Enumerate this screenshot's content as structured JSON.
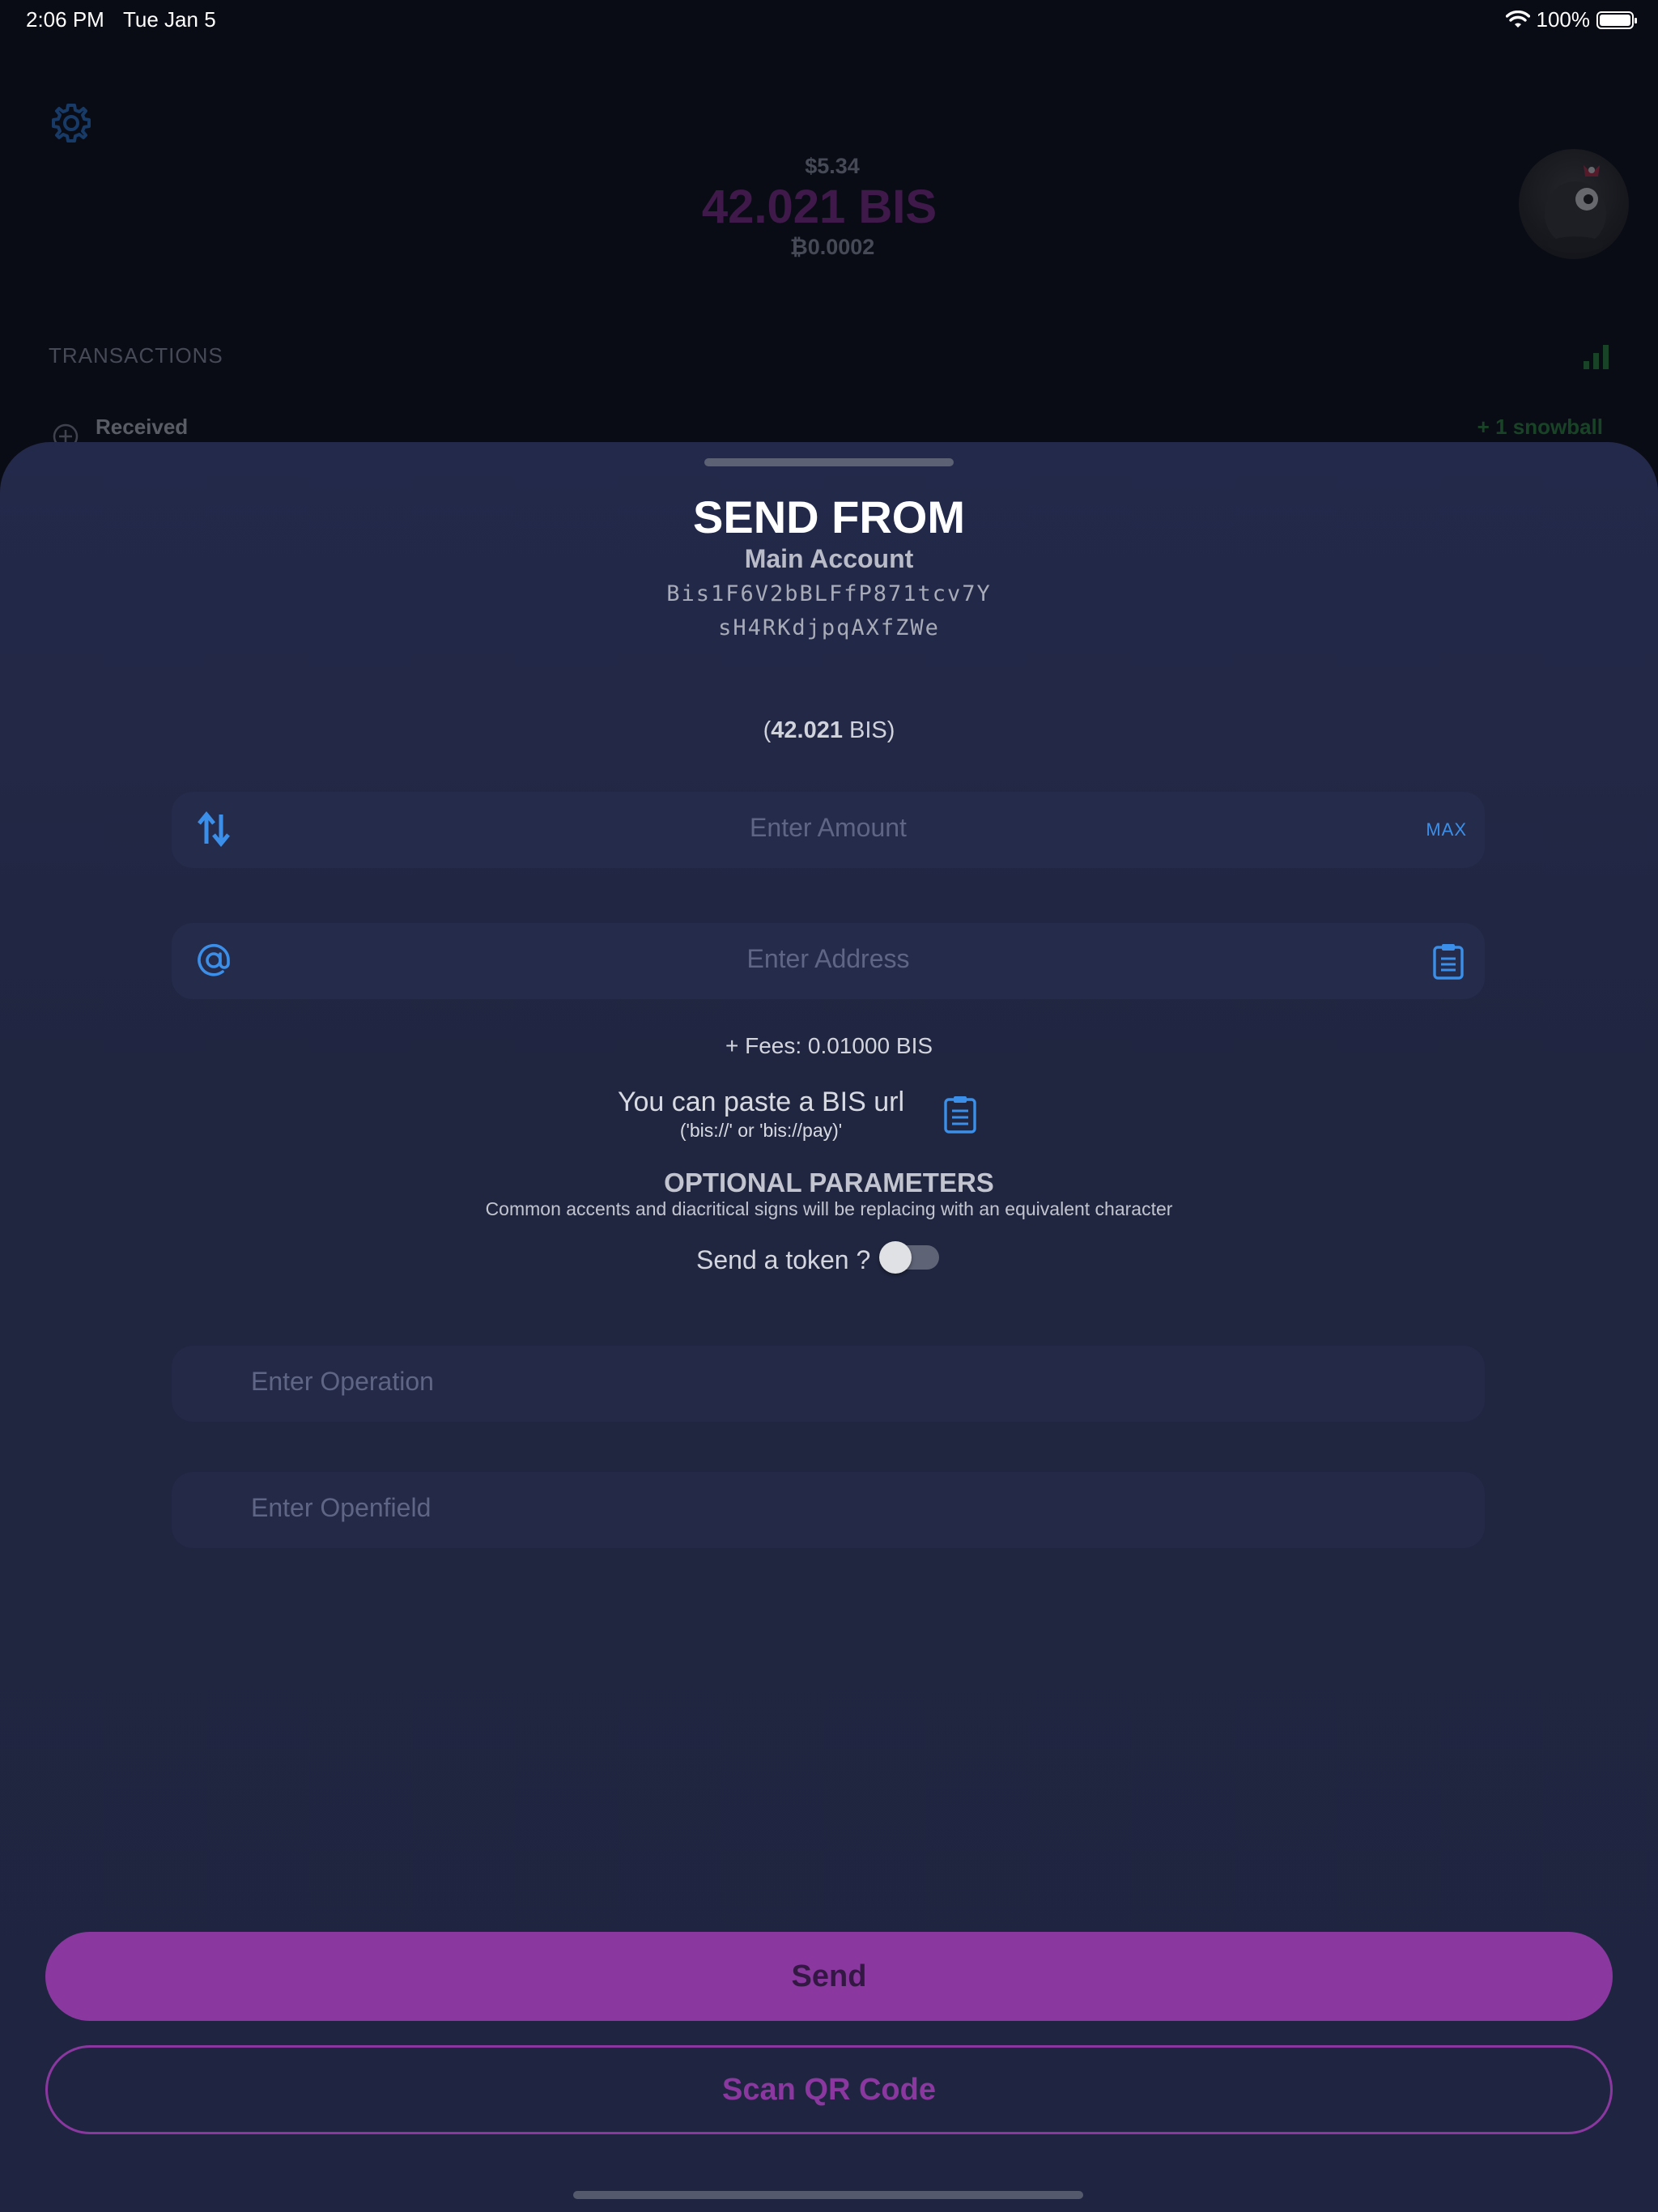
{
  "status_bar": {
    "time": "2:06 PM",
    "date": "Tue Jan 5",
    "battery": "100%"
  },
  "background": {
    "balance_fiat": "$5.34",
    "balance_main": "42.021 BIS",
    "balance_btc": "₿0.0002",
    "transactions_label": "TRANSACTIONS",
    "tx_type": "Received",
    "tx_amount": "+ 1 snowball"
  },
  "sheet": {
    "title": "SEND FROM",
    "account_name": "Main Account",
    "address_line1": "Bis1F6V2bBLFfP871tcv7Y",
    "address_line2": "sH4RKdjpqAXfZWe",
    "balance_open": "(",
    "balance_value": "42.021",
    "balance_unit": " BIS)",
    "amount_placeholder": "Enter Amount",
    "max_label": "MAX",
    "address_placeholder": "Enter Address",
    "fees": "+ Fees: 0.01000 BIS",
    "paste_title": "You can paste a BIS url",
    "paste_sub": "('bis://' or 'bis://pay)'",
    "optional_title": "OPTIONAL PARAMETERS",
    "optional_sub": "Common accents and diacritical signs will be replacing with an equivalent character",
    "token_label": "Send a token ?",
    "token_enabled": false,
    "operation_placeholder": "Enter Operation",
    "openfield_placeholder": "Enter Openfield",
    "send_label": "Send",
    "scan_label": "Scan QR Code"
  },
  "colors": {
    "accent_purple": "#8a38a0",
    "accent_blue": "#3b8fe8",
    "sheet_bg": "#20263f"
  },
  "icons": [
    "settings-gear-icon",
    "swap-arrows-icon",
    "at-sign-icon",
    "clipboard-icon",
    "chart-bars-icon",
    "wifi-icon",
    "battery-icon"
  ]
}
